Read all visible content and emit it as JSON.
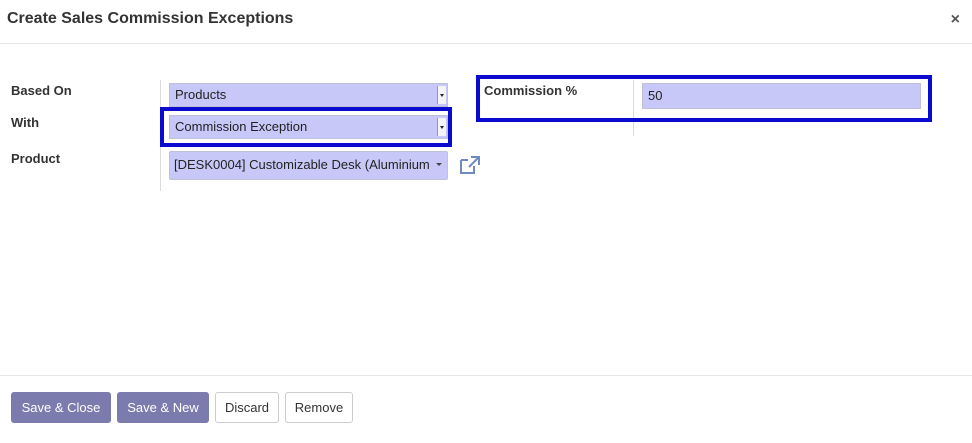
{
  "dialog": {
    "title": "Create Sales Commission Exceptions",
    "close_label": "×"
  },
  "form": {
    "based_on": {
      "label": "Based On",
      "value": "Products"
    },
    "with": {
      "label": "With",
      "value": "Commission Exception"
    },
    "product": {
      "label": "Product",
      "value": "[DESK0004] Customizable Desk (Aluminium"
    },
    "commission": {
      "label": "Commission %",
      "value": "50"
    }
  },
  "footer": {
    "save_close": "Save & Close",
    "save_new": "Save & New",
    "discard": "Discard",
    "remove": "Remove"
  },
  "colors": {
    "highlight": "#0b0bd0",
    "primary": "#7c7bad",
    "field_bg": "#c8c8f8"
  },
  "icons": {
    "external_link": "external-link-icon"
  }
}
